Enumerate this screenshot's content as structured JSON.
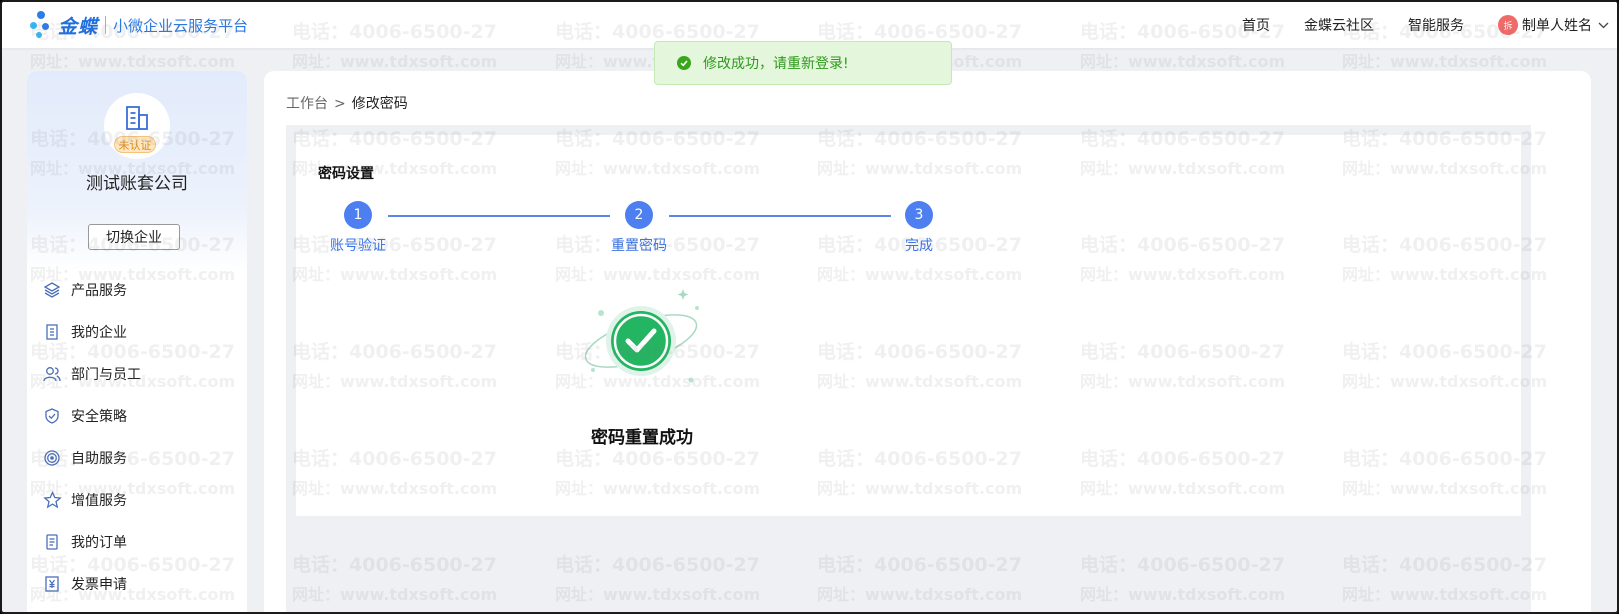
{
  "header": {
    "brand": "金蝶",
    "platform": "小微企业云服务平台",
    "nav": [
      "首页",
      "金蝶云社区",
      "智能服务"
    ],
    "user_avatar": "拆",
    "user_name": "制单人姓名"
  },
  "sidebar": {
    "cert_tag": "未认证",
    "company_name": "测试账套公司",
    "switch_label": "切换企业",
    "items": [
      {
        "label": "产品服务",
        "icon": "layers-icon"
      },
      {
        "label": "我的企业",
        "icon": "building-icon"
      },
      {
        "label": "部门与员工",
        "icon": "users-icon"
      },
      {
        "label": "安全策略",
        "icon": "shield-icon"
      },
      {
        "label": "自助服务",
        "icon": "target-icon"
      },
      {
        "label": "增值服务",
        "icon": "star-icon"
      },
      {
        "label": "我的订单",
        "icon": "document-icon"
      },
      {
        "label": "发票申请",
        "icon": "invoice-icon"
      }
    ]
  },
  "main": {
    "breadcrumb": {
      "home": "工作台",
      "separator": ">",
      "current": "修改密码"
    },
    "panel_title": "密码设置",
    "steps": [
      {
        "number": "1",
        "label": "账号验证"
      },
      {
        "number": "2",
        "label": "重置密码"
      },
      {
        "number": "3",
        "label": "完成"
      }
    ],
    "success_text": "密码重置成功"
  },
  "toast": {
    "message": "修改成功，请重新登录!"
  },
  "watermark": {
    "phone": "电话：4006-6500-27",
    "site": "网址：www.tdxsoft.com"
  },
  "colors": {
    "accent": "#4d7ff0",
    "success": "#2f9a1e",
    "brand": "#1f6fe0"
  }
}
